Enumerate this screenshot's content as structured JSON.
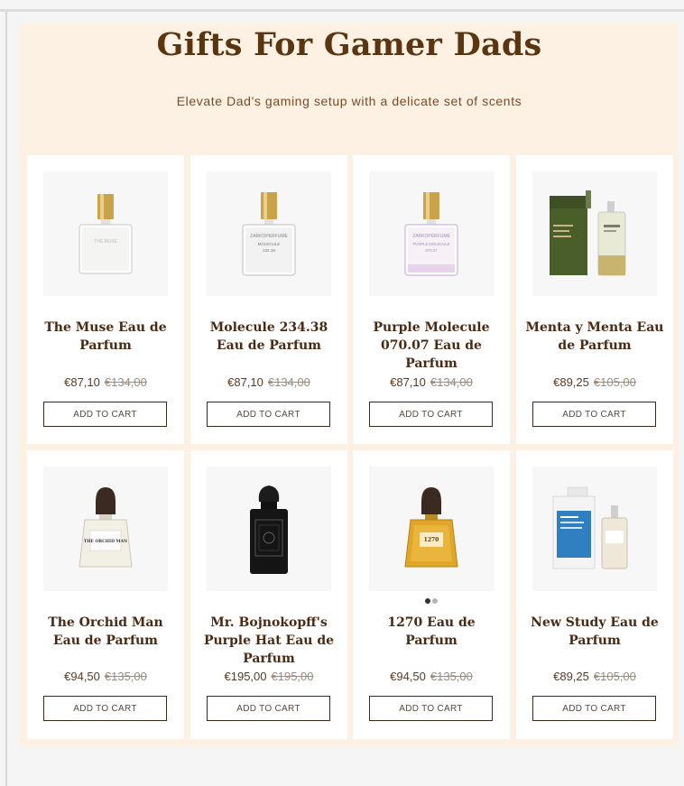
{
  "header": {
    "title": "Gifts For Gamer Dads",
    "subtitle": "Elevate Dad's gaming setup with a delicate set of scents"
  },
  "products": [
    {
      "name": "The Muse Eau de Parfum",
      "price": "€87,10",
      "old_price": "€134,00",
      "cta": "ADD TO CART",
      "icon": "clear-perfume-bottle-gold-cap"
    },
    {
      "name": "Molecule 234.38 Eau de Parfum",
      "price": "€87,10",
      "old_price": "€134,00",
      "cta": "ADD TO CART",
      "icon": "clear-perfume-bottle-gold-cap"
    },
    {
      "name": "Purple Molecule 070.07 Eau de Parfum",
      "price": "€87,10",
      "old_price": "€134,00",
      "cta": "ADD TO CART",
      "icon": "lilac-perfume-bottle-gold-cap"
    },
    {
      "name": "Menta y Menta Eau de Parfum",
      "price": "€89,25",
      "old_price": "€105,00",
      "cta": "ADD TO CART",
      "icon": "green-box-and-bottle"
    },
    {
      "name": "The Orchid Man Eau de Parfum",
      "price": "€94,50",
      "old_price": "€135,00",
      "cta": "ADD TO CART",
      "icon": "clear-bottle-black-cap"
    },
    {
      "name": "Mr. Bojnokopff's Purple Hat Eau de Parfum",
      "price": "€195,00",
      "old_price": "€195,00",
      "cta": "ADD TO CART",
      "icon": "black-ornate-bottle"
    },
    {
      "name": "1270 Eau de Parfum",
      "price": "€94,50",
      "old_price": "€135,00",
      "cta": "ADD TO CART",
      "icon": "amber-bottle-black-cap"
    },
    {
      "name": "New Study Eau de Parfum",
      "price": "€89,25",
      "old_price": "€105,00",
      "cta": "ADD TO CART",
      "icon": "blue-box-and-bottle"
    }
  ],
  "bottle_labels": {
    "muse": "THE MUSE",
    "molecule_brand": "ZARKOPERFUME",
    "molecule_name": "MOLÉCULE",
    "molecule_num": "234.38",
    "purple_brand": "ZARKOPERFUME",
    "purple_name": "PURPLE MOLECULE",
    "purple_num": "070.07",
    "orchid": "THE ORCHID MAN",
    "amber": "1270"
  },
  "carousel": {
    "active_dot": 1,
    "dot_count": 2
  },
  "colors": {
    "panel_bg": "#fdf1e4",
    "title": "#5a3510",
    "card_bg": "#ffffff",
    "button_border": "#3a2a1a"
  }
}
